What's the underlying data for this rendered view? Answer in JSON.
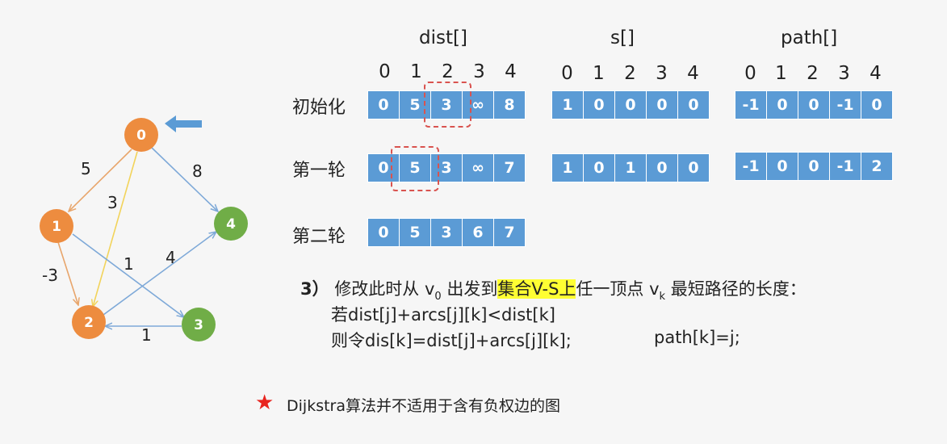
{
  "graph": {
    "nodes": [
      {
        "id": "0",
        "color": "#ed8c3f"
      },
      {
        "id": "1",
        "color": "#ed8c3f"
      },
      {
        "id": "2",
        "color": "#ed8c3f"
      },
      {
        "id": "3",
        "color": "#70ad47"
      },
      {
        "id": "4",
        "color": "#70ad47"
      }
    ],
    "edges": [
      {
        "from": "0",
        "to": "1",
        "weight": "5",
        "color": "#e8a56b"
      },
      {
        "from": "0",
        "to": "2",
        "weight": "3",
        "color": "#f2d35a"
      },
      {
        "from": "0",
        "to": "4",
        "weight": "8",
        "color": "#7ea9d8"
      },
      {
        "from": "1",
        "to": "2",
        "weight": "-3",
        "color": "#e8a56b"
      },
      {
        "from": "1",
        "to": "3",
        "weight": "1",
        "color": "#7ea9d8"
      },
      {
        "from": "2",
        "to": "4",
        "weight": "4",
        "color": "#7ea9d8"
      },
      {
        "from": "3",
        "to": "2",
        "weight": "1",
        "color": "#7ea9d8"
      }
    ],
    "pointer_color": "#5b9bd5"
  },
  "headers": {
    "dist": "dist[]",
    "s": "s[]",
    "path": "path[]"
  },
  "indices": [
    "0",
    "1",
    "2",
    "3",
    "4"
  ],
  "rows": {
    "init": {
      "label": "初始化",
      "dist": [
        "0",
        "5",
        "3",
        "∞",
        "8"
      ],
      "s": [
        "1",
        "0",
        "0",
        "0",
        "0"
      ],
      "path": [
        "-1",
        "0",
        "0",
        "-1",
        "0"
      ]
    },
    "round1": {
      "label": "第一轮",
      "dist": [
        "0",
        "5",
        "3",
        "∞",
        "7"
      ],
      "s": [
        "1",
        "0",
        "1",
        "0",
        "0"
      ],
      "path": [
        "-1",
        "0",
        "0",
        "-1",
        "2"
      ]
    },
    "round2": {
      "label": "第二轮",
      "dist": [
        "0",
        "5",
        "3",
        "6",
        "7"
      ]
    }
  },
  "step": {
    "num": "3）",
    "t1": "修改此时从 v",
    "sub0": "0",
    "t2": " 出发到",
    "highlight": "集合V-S上",
    "t3": "任一顶点 v",
    "subk": "k",
    "t4": " 最短路径的长度：",
    "line2": "若dist[j]+arcs[j][k]<dist[k]",
    "line3a": "则令dis[k]=dist[j]+arcs[j][k];",
    "line3b": "path[k]=j;"
  },
  "note": "Dijkstra算法并不适用于含有负权边的图",
  "colors": {
    "cell": "#5b9bd5",
    "dash": "#d9534f",
    "highlight": "#ffff33",
    "star": "#e8251f"
  }
}
